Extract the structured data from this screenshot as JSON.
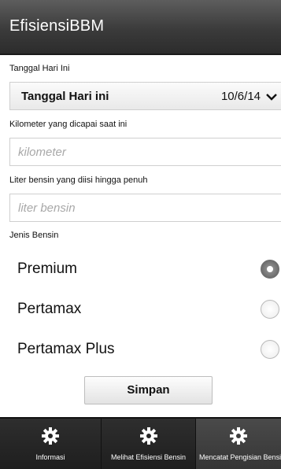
{
  "app": {
    "title": "EfisiensiBBM"
  },
  "form": {
    "date_section_label": "Tanggal Hari Ini",
    "date_picker_label": "Tanggal Hari ini",
    "date_value": "10/6/14",
    "km_label": "Kilometer yang dicapai saat ini",
    "km_placeholder": "kilometer",
    "liter_label": "Liter bensin yang diisi hingga penuh",
    "liter_placeholder": "liter bensin",
    "fuel_type_label": "Jenis Bensin",
    "fuel_options": [
      {
        "label": "Premium",
        "selected": true
      },
      {
        "label": "Pertamax",
        "selected": false
      },
      {
        "label": "Pertamax Plus",
        "selected": false
      }
    ],
    "save_label": "Simpan"
  },
  "tabs": [
    {
      "label": "Informasi",
      "icon": "gear-icon",
      "active": false
    },
    {
      "label": "Melihat Efisiensi Bensin",
      "icon": "gear-icon",
      "active": false
    },
    {
      "label": "Mencatat Pengisian Bensin",
      "icon": "gear-icon",
      "active": true
    }
  ],
  "colors": {
    "titlebar": "#3b3b3b",
    "tabbar": "#262626",
    "tab_active": "#404040"
  }
}
